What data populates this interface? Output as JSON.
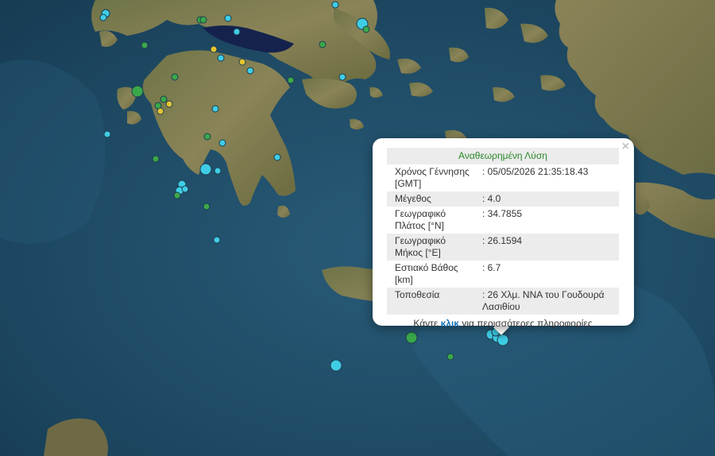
{
  "popup": {
    "title": "Αναθεωρημένη Λύση",
    "close_glyph": "×",
    "rows": [
      {
        "label": "Χρόνος Γέννησης [GMT]",
        "value": ": 05/05/2026 21:35:18.43"
      },
      {
        "label": "Μέγεθος",
        "value": ": 4.0"
      },
      {
        "label": "Γεωγραφικό Πλάτος [°N]",
        "value": ": 34.7855"
      },
      {
        "label": "Γεωγραφικό Μήκος [°E]",
        "value": ": 26.1594"
      },
      {
        "label": "Εστιακό Βάθος [km]",
        "value": ": 6.7"
      },
      {
        "label": "Τοποθεσία",
        "value": ": 26 Χλμ. ΝΝΑ του Γουδουρά Λασιθίου"
      }
    ],
    "more_prefix": "Κάντε ",
    "more_link": "κλικ",
    "more_suffix": " για περισσότερες πληροφορίες"
  },
  "colors": {
    "sea": "#1e4a63",
    "land": "#7d7a4e",
    "marker_cyan": "#3fcde6",
    "marker_green": "#3aa84a",
    "marker_yellow": "#e3c431",
    "lake": "#15224e"
  }
}
